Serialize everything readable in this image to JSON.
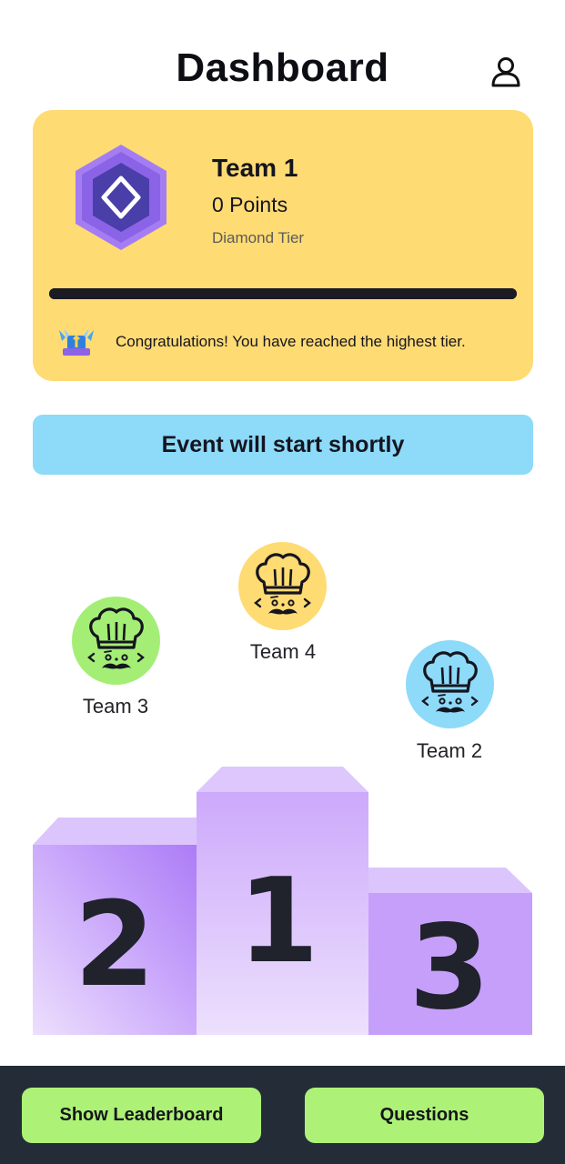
{
  "header": {
    "title": "Dashboard",
    "profile_icon": "user-icon"
  },
  "team_card": {
    "name": "Team 1",
    "points": "0 Points",
    "tier": "Diamond Tier",
    "progress": 1.0,
    "badge_icon": "diamond-tier-badge-icon",
    "trophy_icon": "tier-trophy-icon",
    "message": "Congratulations! You have reached the highest tier.",
    "bg_color": "#fedb73"
  },
  "event_banner": {
    "text": "Event will start shortly",
    "bg_color": "#8ddaf9"
  },
  "podium": {
    "teams": [
      {
        "name": "Team 4",
        "avatar_color": "#fedb73",
        "icon": "chef-icon"
      },
      {
        "name": "Team 3",
        "avatar_color": "#a4ee76",
        "icon": "chef-icon"
      },
      {
        "name": "Team 2",
        "avatar_color": "#8ddaf9",
        "icon": "chef-icon"
      }
    ],
    "places": [
      "2",
      "1",
      "3"
    ],
    "block_color": "#c9a3fb"
  },
  "bottom_bar": {
    "leaderboard_label": "Show Leaderboard",
    "questions_label": "Questions",
    "button_color": "#adf276"
  }
}
